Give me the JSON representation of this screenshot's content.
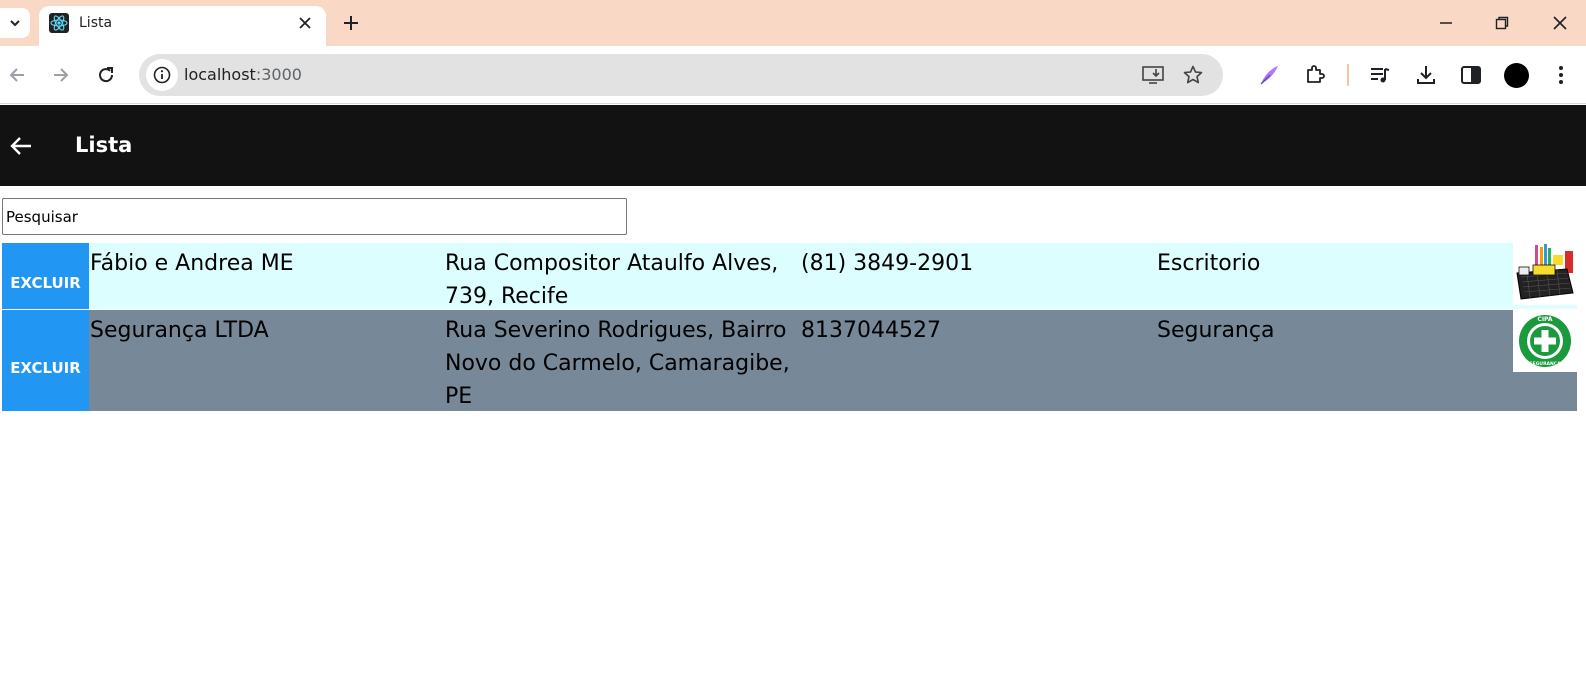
{
  "browser": {
    "tab_title": "Lista",
    "url_host": "localhost",
    "url_port": ":3000"
  },
  "app": {
    "title": "Lista",
    "search_placeholder": "Pesquisar"
  },
  "rows": [
    {
      "delete_label": "EXCLUIR",
      "name": "Fábio e Andrea ME",
      "address": "Rua Compositor Ataulfo Alves, 739, Recife",
      "phone": "(81) 3849-2901",
      "category": "Escritorio",
      "image_icon": "desk-organizer-image",
      "bg_color": "#dcfefe"
    },
    {
      "delete_label": "EXCLUIR",
      "name": "Segurança LTDA",
      "address": "Rua Severino Rodrigues, Bairro Novo do Carmelo, Camaragibe, PE",
      "phone": "8137044527",
      "category": "Segurança",
      "image_icon": "cipa-seguranca-logo",
      "image_logo_text": "CIPA SEGURANÇA",
      "bg_color": "#778899"
    }
  ],
  "colors": {
    "tabstrip": "#fad8c6",
    "app_bar": "#121212",
    "delete_button": "#2196f3"
  }
}
